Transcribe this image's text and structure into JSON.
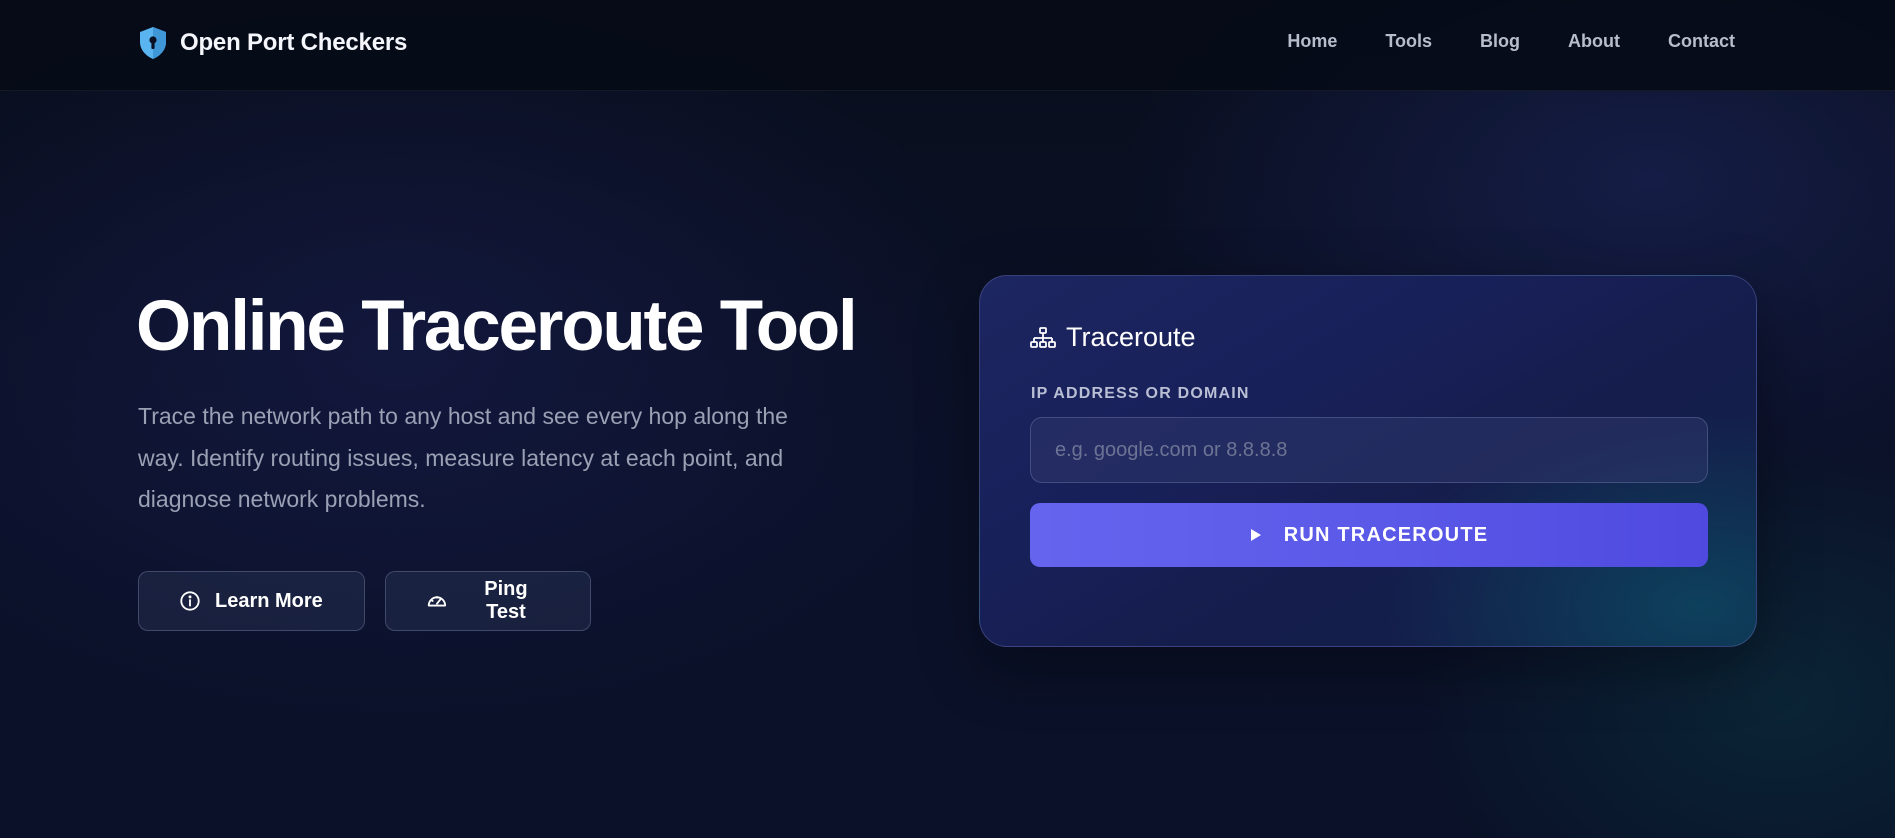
{
  "brand": {
    "name": "Open Port Checkers",
    "icon": "shield-lock-icon"
  },
  "nav": {
    "items": [
      "Home",
      "Tools",
      "Blog",
      "About",
      "Contact"
    ]
  },
  "hero": {
    "title": "Online Traceroute Tool",
    "description": "Trace the network path to any host and see every hop along the way. Identify routing issues, measure latency at each point, and diagnose network problems.",
    "buttons": {
      "learn_more": {
        "label": "Learn More",
        "icon": "info-circle-icon"
      },
      "ping_test": {
        "label": "Ping Test",
        "icon": "speedometer-icon"
      }
    }
  },
  "card": {
    "title": "Traceroute",
    "title_icon": "network-diagram-icon",
    "field_label": "IP ADDRESS OR DOMAIN",
    "input_placeholder": "e.g. google.com or 8.8.8.8",
    "input_value": "",
    "run_label": "RUN TRACEROUTE",
    "run_icon": "play-icon"
  },
  "colors": {
    "background": "#0a1024",
    "accent": "#5b5ae8",
    "brand_icon": "#5ab4f0",
    "text_muted": "#9aa1b4"
  }
}
